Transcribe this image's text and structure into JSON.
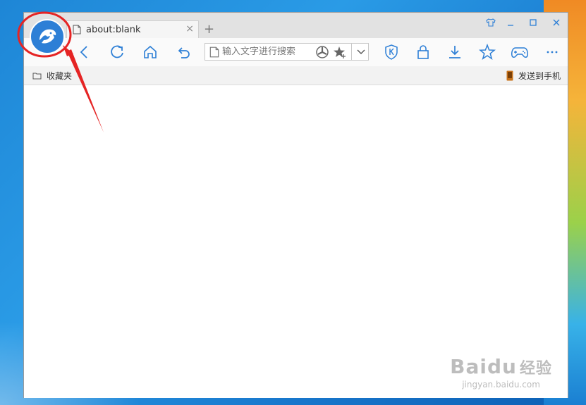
{
  "tab": {
    "title": "about:blank",
    "close": "×",
    "new": "+"
  },
  "address_bar": {
    "placeholder": "输入文字进行搜索"
  },
  "bookmarks": {
    "favorites_label": "收藏夹",
    "send_to_phone_label": "发送到手机"
  },
  "watermark": {
    "brand": "Baidu",
    "brand_cn": "经验",
    "url": "jingyan.baidu.com"
  },
  "colors": {
    "accent": "#2d7fd6",
    "annotation": "#e52424",
    "titlebar": "#e2e2e2"
  },
  "icons": {
    "logo": "panther-logo-icon",
    "tab": "page-icon",
    "toolbar": [
      "back-icon",
      "refresh-icon",
      "home-icon",
      "undo-icon",
      "speed-dial-icon",
      "favorite-add-icon",
      "chevron-down-icon",
      "shield-k-icon",
      "lock-icon",
      "download-icon",
      "star-icon",
      "gamepad-icon",
      "more-icon"
    ],
    "window": [
      "skin-icon",
      "minimize-icon",
      "maximize-icon",
      "close-icon"
    ]
  }
}
